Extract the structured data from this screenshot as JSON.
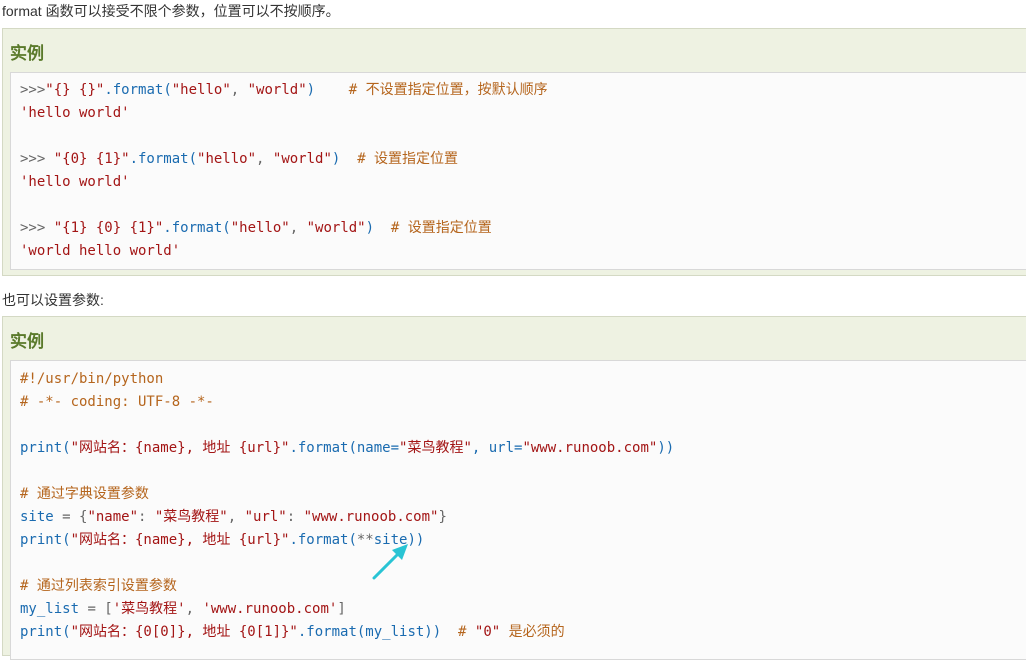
{
  "intro_text": "format 函数可以接受不限个参数，位置可以不按顺序。",
  "example1": {
    "title": "实例",
    "lines": [
      [
        {
          "t": ">>>",
          "c": "pl"
        },
        {
          "t": "\"{} {}\"",
          "c": "str"
        },
        {
          "t": ".format(",
          "c": "fn"
        },
        {
          "t": "\"hello\"",
          "c": "str"
        },
        {
          "t": ", ",
          "c": "pl"
        },
        {
          "t": "\"world\"",
          "c": "str"
        },
        {
          "t": ")    ",
          "c": "fn"
        },
        {
          "t": "# 不设置指定位置，按默认顺序",
          "c": "cm"
        }
      ],
      [
        {
          "t": "'hello world'",
          "c": "out"
        }
      ],
      [
        {
          "t": ">>> ",
          "c": "pl"
        },
        {
          "t": "\"{0} {1}\"",
          "c": "str"
        },
        {
          "t": ".format(",
          "c": "fn"
        },
        {
          "t": "\"hello\"",
          "c": "str"
        },
        {
          "t": ", ",
          "c": "pl"
        },
        {
          "t": "\"world\"",
          "c": "str"
        },
        {
          "t": ")  ",
          "c": "fn"
        },
        {
          "t": "# 设置指定位置",
          "c": "cm"
        }
      ],
      [
        {
          "t": "'hello world'",
          "c": "out"
        }
      ],
      [
        {
          "t": ">>> ",
          "c": "pl"
        },
        {
          "t": "\"{1} {0} {1}\"",
          "c": "str"
        },
        {
          "t": ".format(",
          "c": "fn"
        },
        {
          "t": "\"hello\"",
          "c": "str"
        },
        {
          "t": ", ",
          "c": "pl"
        },
        {
          "t": "\"world\"",
          "c": "str"
        },
        {
          "t": ")  ",
          "c": "fn"
        },
        {
          "t": "# 设置指定位置",
          "c": "cm"
        }
      ],
      [
        {
          "t": "'world hello world'",
          "c": "out"
        }
      ]
    ]
  },
  "middle_text": "也可以设置参数:",
  "example2": {
    "title": "实例",
    "lines": [
      [
        {
          "t": "#!/usr/bin/python",
          "c": "cm"
        }
      ],
      [
        {
          "t": "# -*- coding: UTF-8 -*-",
          "c": "cm"
        }
      ],
      [
        {
          "t": "print(",
          "c": "fn"
        },
        {
          "t": "\"网站名：{name}, 地址 {url}\"",
          "c": "str"
        },
        {
          "t": ".format(name=",
          "c": "fn"
        },
        {
          "t": "\"菜鸟教程\"",
          "c": "str"
        },
        {
          "t": ", url=",
          "c": "fn"
        },
        {
          "t": "\"www.runoob.com\"",
          "c": "str"
        },
        {
          "t": "))",
          "c": "fn"
        }
      ],
      [
        {
          "t": "# 通过字典设置参数",
          "c": "cm"
        }
      ],
      [
        {
          "t": "site",
          "c": "var"
        },
        {
          "t": " = {",
          "c": "pl"
        },
        {
          "t": "\"name\"",
          "c": "str"
        },
        {
          "t": ": ",
          "c": "pl"
        },
        {
          "t": "\"菜鸟教程\"",
          "c": "str"
        },
        {
          "t": ", ",
          "c": "pl"
        },
        {
          "t": "\"url\"",
          "c": "str"
        },
        {
          "t": ": ",
          "c": "pl"
        },
        {
          "t": "\"www.runoob.com\"",
          "c": "str"
        },
        {
          "t": "}",
          "c": "pl"
        }
      ],
      [
        {
          "t": "print(",
          "c": "fn"
        },
        {
          "t": "\"网站名：{name}, 地址 {url}\"",
          "c": "str"
        },
        {
          "t": ".format(",
          "c": "fn"
        },
        {
          "t": "**",
          "c": "pl"
        },
        {
          "t": "site))",
          "c": "fn"
        }
      ],
      [
        {
          "t": "# 通过列表索引设置参数",
          "c": "cm"
        }
      ],
      [
        {
          "t": "my_list",
          "c": "var"
        },
        {
          "t": " = [",
          "c": "pl"
        },
        {
          "t": "'菜鸟教程'",
          "c": "str"
        },
        {
          "t": ", ",
          "c": "pl"
        },
        {
          "t": "'www.runoob.com'",
          "c": "str"
        },
        {
          "t": "]",
          "c": "pl"
        }
      ],
      [
        {
          "t": "print(",
          "c": "fn"
        },
        {
          "t": "\"网站名：{0[0]}, 地址 {0[1]}\"",
          "c": "str"
        },
        {
          "t": ".format(my_list))  ",
          "c": "fn"
        },
        {
          "t": "# ",
          "c": "cm"
        },
        {
          "t": "\"0\"",
          "c": "str"
        },
        {
          "t": " 是必须的",
          "c": "cm"
        }
      ]
    ]
  },
  "annotation": {
    "color": "#29c4d4",
    "icon": "arrow-icon"
  }
}
